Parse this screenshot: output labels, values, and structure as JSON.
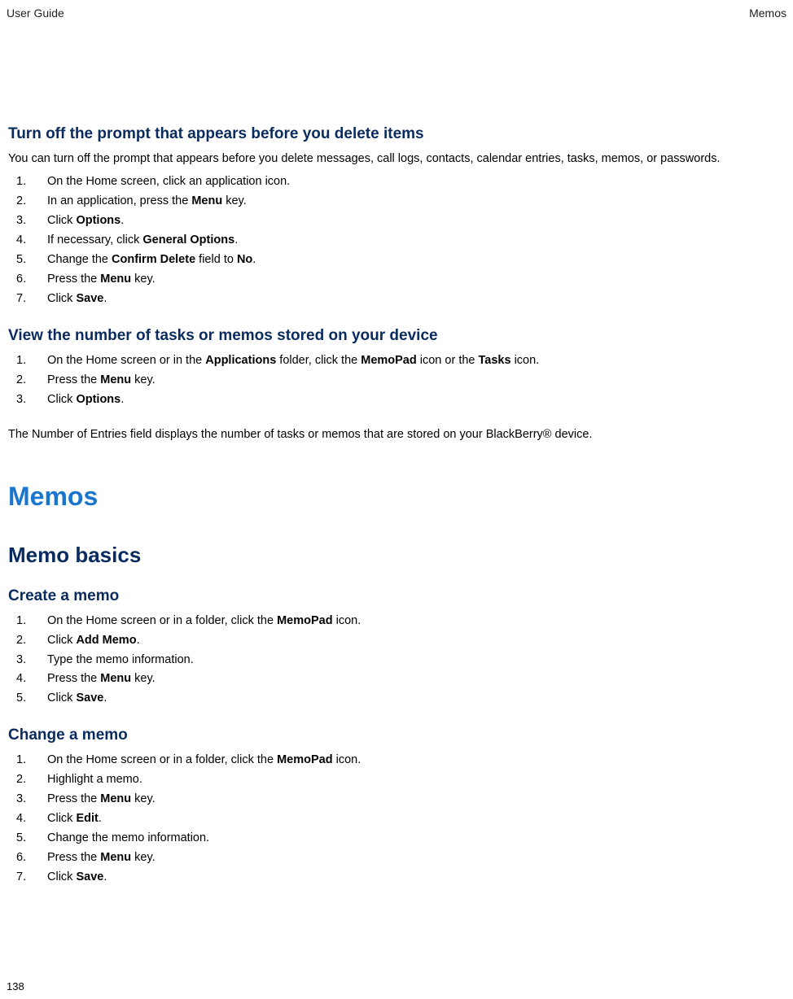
{
  "header": {
    "left": "User Guide",
    "right": "Memos"
  },
  "sec1": {
    "title": "Turn off the prompt that appears before you delete items",
    "intro": "You can turn off the prompt that appears before you delete messages, call logs, contacts, calendar entries, tasks, memos, or passwords.",
    "steps": {
      "s1": "On the Home screen, click an application icon.",
      "s2a": "In an application, press the ",
      "s2b": "Menu",
      "s2c": " key.",
      "s3a": "Click ",
      "s3b": "Options",
      "s3c": ".",
      "s4a": "If necessary, click ",
      "s4b": "General Options",
      "s4c": ".",
      "s5a": "Change the ",
      "s5b": "Confirm Delete",
      "s5c": " field to ",
      "s5d": "No",
      "s5e": ".",
      "s6a": "Press the ",
      "s6b": "Menu",
      "s6c": " key.",
      "s7a": "Click ",
      "s7b": "Save",
      "s7c": "."
    }
  },
  "sec2": {
    "title": "View the number of tasks or memos stored on your device",
    "steps": {
      "s1a": "On the Home screen or in the ",
      "s1b": "Applications",
      "s1c": " folder, click the ",
      "s1d": "MemoPad",
      "s1e": " icon or the ",
      "s1f": "Tasks",
      "s1g": " icon.",
      "s2a": "Press the ",
      "s2b": "Menu",
      "s2c": " key.",
      "s3a": "Click ",
      "s3b": "Options",
      "s3c": "."
    },
    "note": "The Number of Entries field displays the number of tasks or memos that are stored on your BlackBerry® device."
  },
  "h1": "Memos",
  "h2": "Memo basics",
  "sec3": {
    "title": "Create a memo",
    "steps": {
      "s1a": "On the Home screen or in a folder, click the ",
      "s1b": "MemoPad",
      "s1c": " icon.",
      "s2a": "Click ",
      "s2b": "Add Memo",
      "s2c": ".",
      "s3": "Type the memo information.",
      "s4a": "Press the ",
      "s4b": "Menu",
      "s4c": " key.",
      "s5a": "Click ",
      "s5b": "Save",
      "s5c": "."
    }
  },
  "sec4": {
    "title": "Change a memo",
    "steps": {
      "s1a": "On the Home screen or in a folder, click the ",
      "s1b": "MemoPad",
      "s1c": " icon.",
      "s2": "Highlight a memo.",
      "s3a": "Press the ",
      "s3b": "Menu",
      "s3c": " key.",
      "s4a": "Click ",
      "s4b": "Edit",
      "s4c": ".",
      "s5": "Change the memo information.",
      "s6a": "Press the ",
      "s6b": "Menu",
      "s6c": " key.",
      "s7a": "Click ",
      "s7b": "Save",
      "s7c": "."
    }
  },
  "page": "138"
}
